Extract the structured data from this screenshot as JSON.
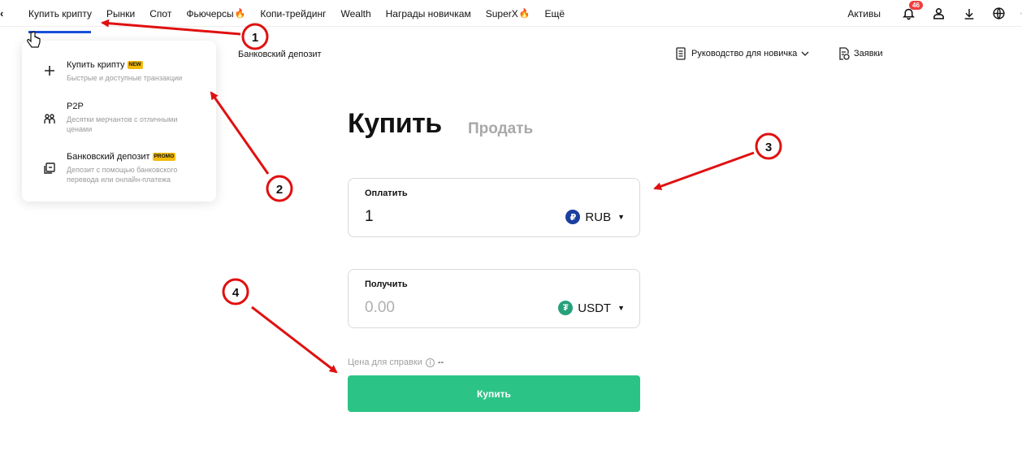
{
  "topnav": {
    "items": [
      {
        "label": "Купить крипту"
      },
      {
        "label": "Рынки"
      },
      {
        "label": "Спот"
      },
      {
        "label": "Фьючерсы",
        "icon": "fire-icon"
      },
      {
        "label": "Копи-трейдинг"
      },
      {
        "label": "Wealth"
      },
      {
        "label": "Награды новичкам"
      },
      {
        "label": "SuperX",
        "icon": "fire-icon"
      },
      {
        "label": "Ещё"
      }
    ],
    "assets_label": "Активы",
    "notifications_count": "46"
  },
  "dropdown": {
    "items": [
      {
        "title": "Купить крипту",
        "badge": "NEW",
        "description": "Быстрые и доступные транзакции",
        "icon": "plus-icon"
      },
      {
        "title": "P2P",
        "description": "Десятки мерчантов с отличными ценами",
        "icon": "people-icon"
      },
      {
        "title": "Банковский депозит",
        "badge": "PROMO",
        "description": "Депозит с помощью банковского перевода или онлайн-платежа",
        "icon": "bank-deposit-icon"
      }
    ]
  },
  "subbar": {
    "bank_deposit_link": "Банковский депозит",
    "guide_label": "Руководство для новичка",
    "orders_label": "Заявки"
  },
  "trade": {
    "tab_buy": "Купить",
    "tab_sell": "Продать",
    "pay_label": "Оплатить",
    "pay_value": "1",
    "pay_currency": "RUB",
    "pay_currency_symbol": "₽",
    "receive_label": "Получить",
    "receive_placeholder": "0.00",
    "receive_currency": "USDT",
    "receive_currency_symbol": "₮",
    "ref_price_label": "Цена для справки",
    "ref_price_value": "--",
    "buy_button": "Купить"
  },
  "colors": {
    "accent_blue": "#1a4fd6",
    "buy_green": "#2cc387",
    "annotation_red": "#e01010",
    "rub_blue": "#1a3fa0",
    "usdt_green": "#26a17b"
  },
  "annotations": [
    "1",
    "2",
    "3",
    "4"
  ]
}
